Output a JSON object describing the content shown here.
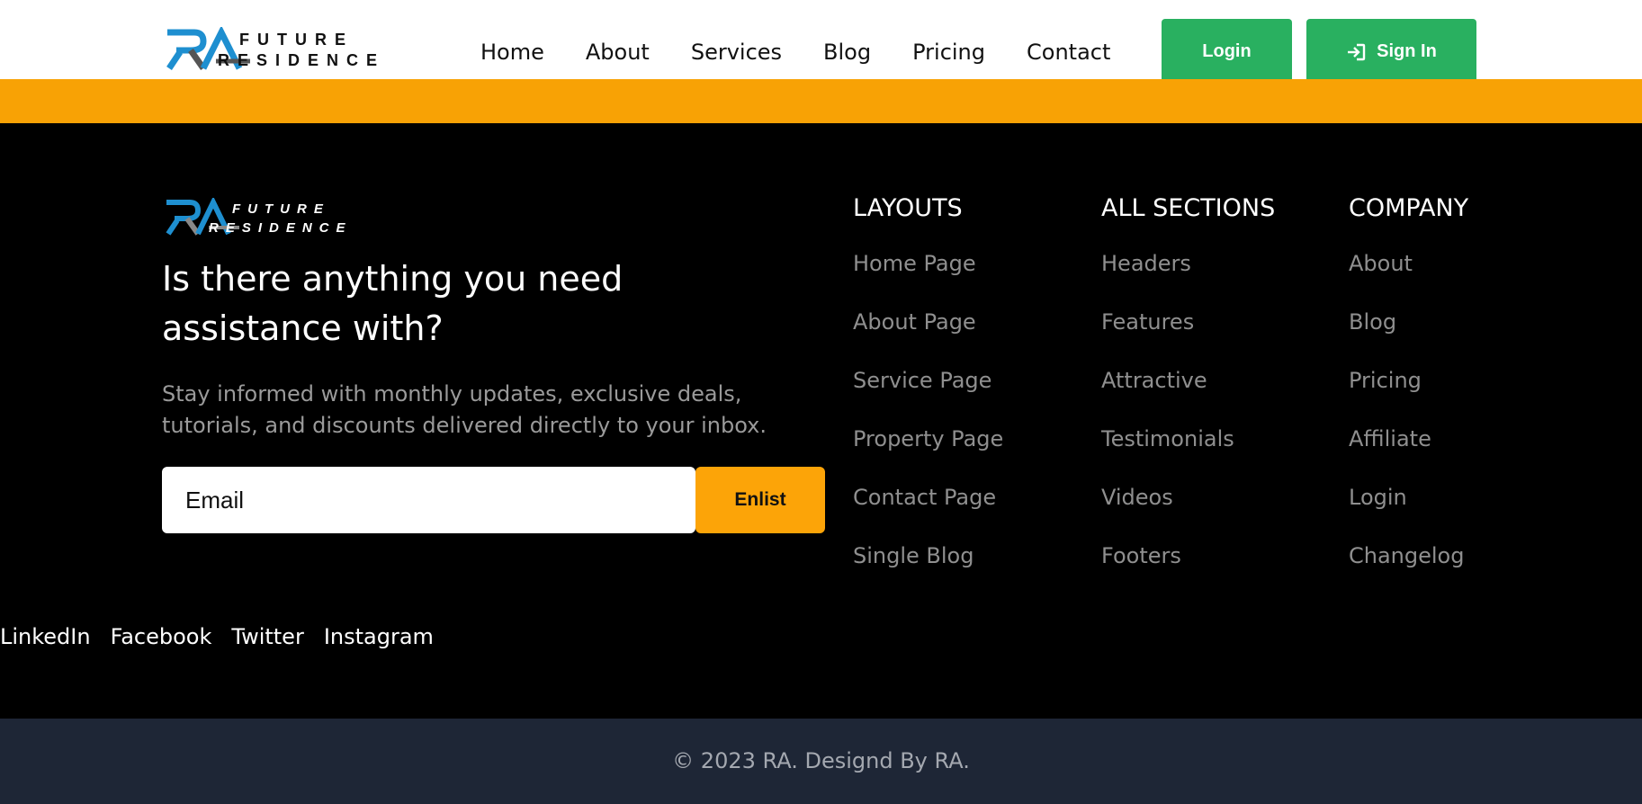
{
  "brand": {
    "logo_mark": "RA",
    "logo_line1": "FUTURE",
    "logo_line2": "RESIDENCE",
    "colors": {
      "blue": "#1e8fd0",
      "grey": "#555555"
    }
  },
  "header": {
    "nav": [
      "Home",
      "About",
      "Services",
      "Blog",
      "Pricing",
      "Contact"
    ],
    "login_label": "Login",
    "signin_label": "Sign In",
    "signin_icon": "sign-in-icon",
    "button_color": "#29b060"
  },
  "stripe": {
    "color": "#f8a205"
  },
  "footer": {
    "headline": "Is there anything you need assistance with?",
    "description": "Stay informed with monthly updates, exclusive deals, tutorials, and discounts delivered directly to your inbox.",
    "email_placeholder": "Email",
    "enlist_label": "Enlist",
    "accent_color": "#fca408",
    "columns": [
      {
        "title": "LAYOUTS",
        "links": [
          "Home Page",
          "About Page",
          "Service Page",
          "Property Page",
          "Contact Page",
          "Single Blog"
        ]
      },
      {
        "title": "ALL SECTIONS",
        "links": [
          "Headers",
          "Features",
          "Attractive",
          "Testimonials",
          "Videos",
          "Footers"
        ]
      },
      {
        "title": "COMPANY",
        "links": [
          "About",
          "Blog",
          "Pricing",
          "Affiliate",
          "Login",
          "Changelog"
        ]
      }
    ],
    "social": [
      "LinkedIn",
      "Facebook",
      "Twitter",
      "Instagram"
    ]
  },
  "bottom": {
    "copyright": "© 2023 RA. Designd By RA.",
    "color": "#1e2636"
  }
}
